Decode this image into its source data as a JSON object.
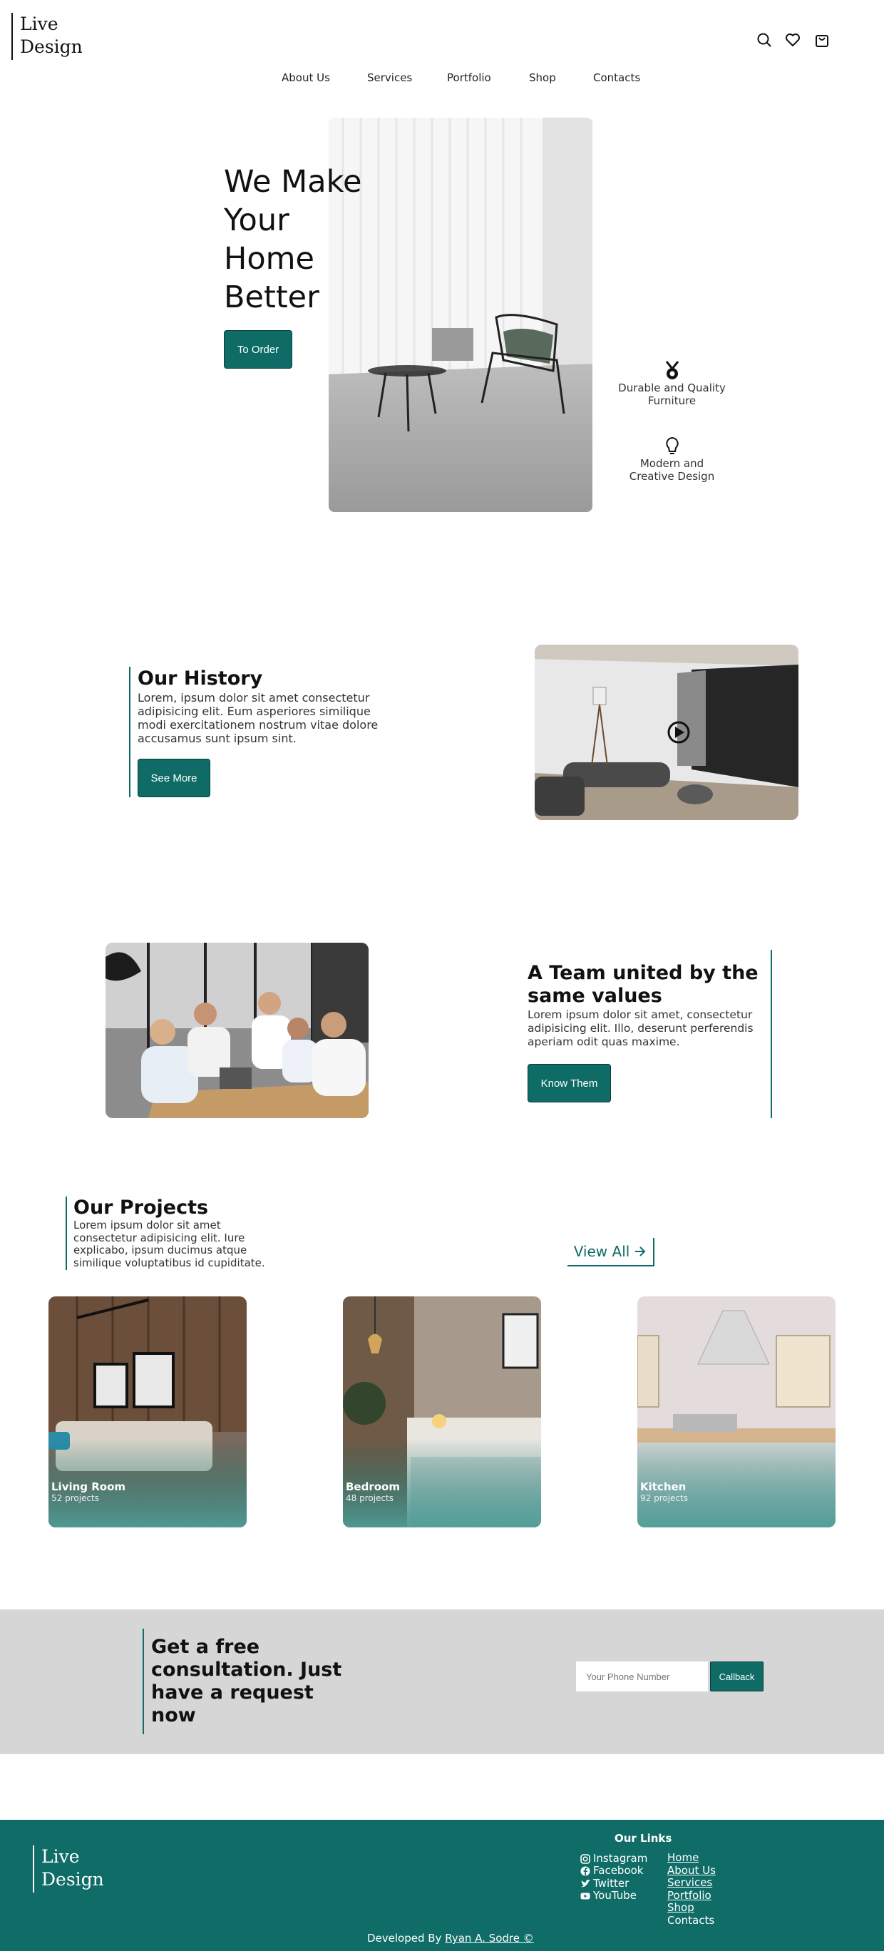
{
  "brand": {
    "line1": "Live",
    "line2": "Design"
  },
  "header_icons": [
    "search-icon",
    "heart-icon",
    "shopping-bag-icon"
  ],
  "nav": [
    "About Us",
    "Services",
    "Portfolio",
    "Shop",
    "Contacts"
  ],
  "hero": {
    "title_lines": [
      "We Make",
      "Your",
      "Home",
      "Better"
    ],
    "cta": "To Order",
    "features": [
      {
        "icon": "medal-icon",
        "line1": "Durable and Quality",
        "line2": "Furniture"
      },
      {
        "icon": "lightbulb-icon",
        "line1": "Modern and",
        "line2": "Creative Design"
      }
    ]
  },
  "history": {
    "title": "Our History",
    "text": [
      "Lorem, ipsum dolor sit amet consectetur",
      "adipisicing elit. Eum asperiores similique",
      "modi exercitationem nostrum vitae dolore",
      "accusamus sunt ipsum sint."
    ],
    "cta": "See More"
  },
  "team": {
    "title_lines": [
      "A Team united by the",
      "same values"
    ],
    "text": [
      "Lorem ipsum dolor sit amet, consectetur",
      "adipisicing elit. Illo, deserunt perferendis",
      "aperiam odit quas maxime."
    ],
    "cta": "Know Them"
  },
  "projects": {
    "title": "Our Projects",
    "text": [
      "Lorem ipsum dolor sit amet",
      "consectetur adipisicing elit. Iure",
      "explicabo, ipsum ducimus atque",
      "similique voluptatibus id cupiditate."
    ],
    "view_all": "View All",
    "cards": [
      {
        "name": "Living Room",
        "count": "52 projects"
      },
      {
        "name": "Bedroom",
        "count": "48 projects"
      },
      {
        "name": "Kitchen",
        "count": "92 projects"
      }
    ]
  },
  "consultation": {
    "title_lines": [
      "Get a free",
      "consultation. Just",
      "have a request",
      "now"
    ],
    "placeholder": "Your Phone Number",
    "button": "Callback"
  },
  "footer": {
    "brand": {
      "line1": "Live",
      "line2": "Design"
    },
    "links_title": "Our Links",
    "social": [
      {
        "icon": "instagram-icon",
        "label": "Instagram"
      },
      {
        "icon": "facebook-icon",
        "label": "Facebook"
      },
      {
        "icon": "twitter-icon",
        "label": "Twitter"
      },
      {
        "icon": "youtube-icon",
        "label": "YouTube"
      }
    ],
    "links": [
      "Home",
      "About Us",
      "Services",
      "Portfolio",
      "Shop"
    ],
    "contacts": "Contacts",
    "credit_prefix": "Developed By",
    "credit_name": "Ryan A. Sodre ©"
  },
  "colors": {
    "accent": "#0e6b65",
    "accent_dark": "#0a3f3b",
    "band": "#d6d6d6",
    "footer": "#106c67"
  }
}
